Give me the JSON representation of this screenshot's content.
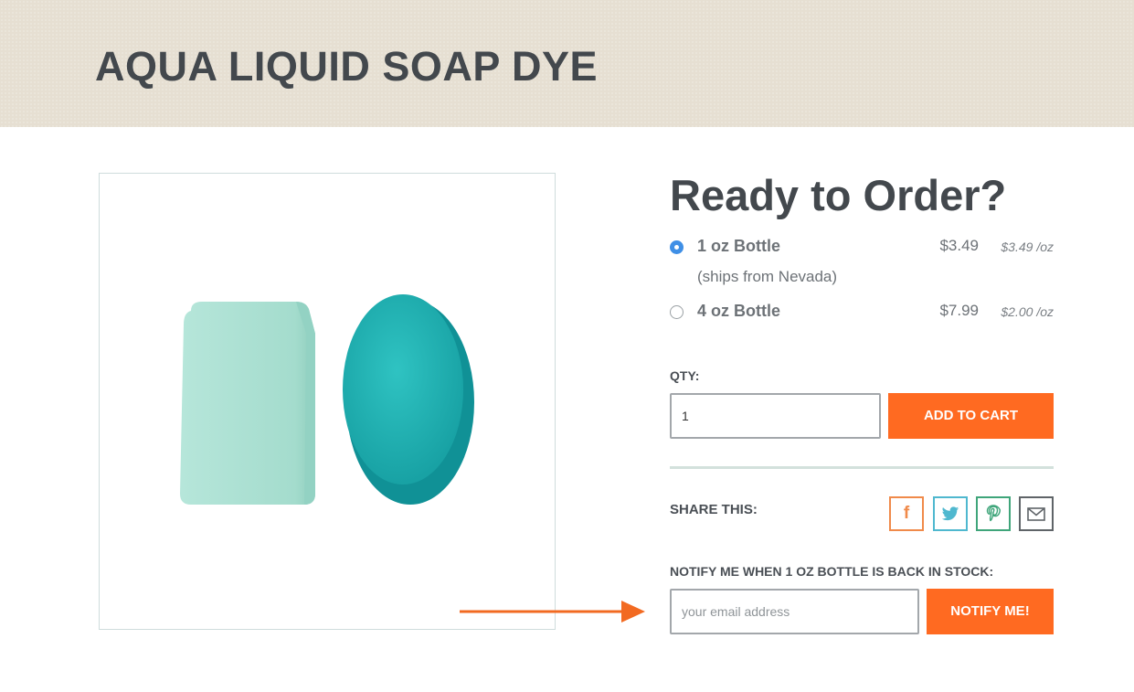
{
  "banner": {
    "title": "AQUA LIQUID SOAP DYE"
  },
  "product": {
    "image_alt": "Aqua soap bars"
  },
  "order": {
    "heading": "Ready to Order?",
    "options": [
      {
        "label": "1 oz Bottle",
        "note": "(ships from Nevada)",
        "price": "$3.49",
        "unit_price": "$3.49 /oz",
        "selected": true
      },
      {
        "label": "4 oz Bottle",
        "price": "$7.99",
        "unit_price": "$2.00 /oz",
        "selected": false
      }
    ],
    "qty_label": "QTY:",
    "qty_value": "1",
    "add_to_cart_label": "ADD TO CART"
  },
  "share": {
    "label": "SHARE THIS:",
    "facebook_glyph": "f",
    "buttons": [
      "facebook-icon",
      "twitter-icon",
      "pinterest-icon",
      "email-icon"
    ]
  },
  "notify": {
    "label": "NOTIFY ME WHEN 1 OZ BOTTLE IS BACK IN STOCK:",
    "email_placeholder": "your email address",
    "button_label": "NOTIFY ME!"
  },
  "colors": {
    "accent_orange": "#ff6a21",
    "banner_bg": "#e6dfd2",
    "heading_text": "#43484d",
    "radio_selected": "#3f8fe6",
    "soap_light": "#a8e0d2",
    "soap_teal": "#1fb1b1"
  }
}
